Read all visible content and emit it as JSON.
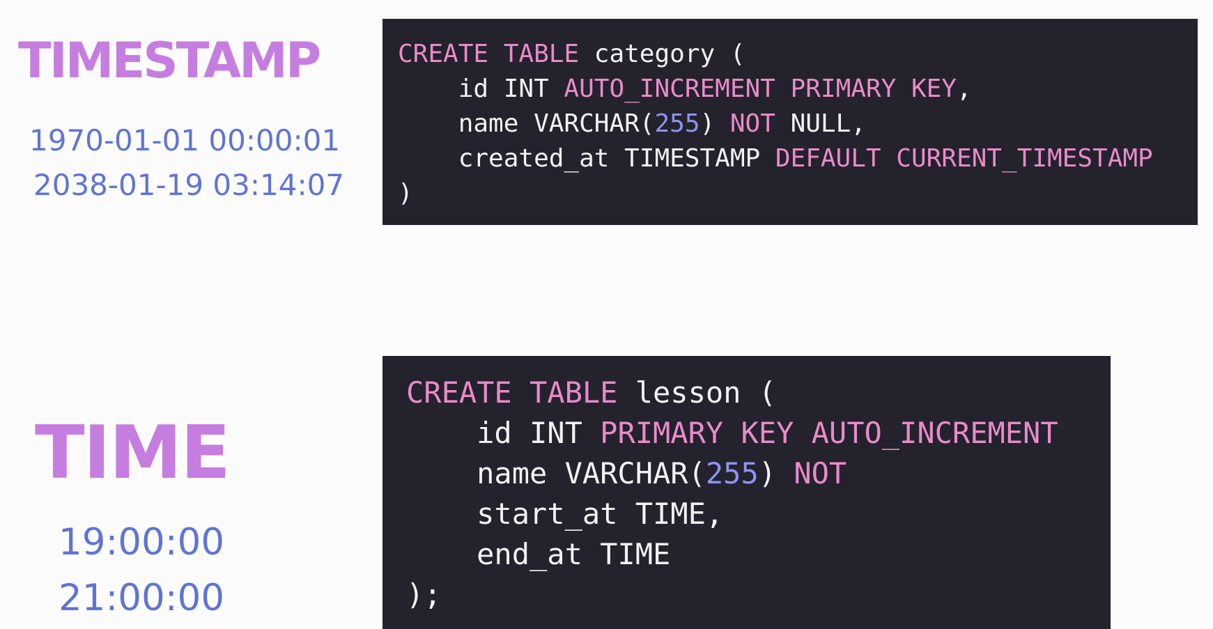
{
  "timestamp_section": {
    "heading": "TIMESTAMP",
    "range_min": "1970-01-01 00:00:01",
    "range_max": "2038-01-19 03:14:07",
    "code_lines": [
      [
        {
          "t": "CREATE",
          "k": "kw"
        },
        {
          "t": " ",
          "k": "plain"
        },
        {
          "t": "TABLE",
          "k": "kw"
        },
        {
          "t": " category (",
          "k": "plain"
        }
      ],
      [
        {
          "t": "    id INT ",
          "k": "plain"
        },
        {
          "t": "AUTO_INCREMENT",
          "k": "kw"
        },
        {
          "t": " ",
          "k": "plain"
        },
        {
          "t": "PRIMARY",
          "k": "kw"
        },
        {
          "t": " ",
          "k": "plain"
        },
        {
          "t": "KEY",
          "k": "kw"
        },
        {
          "t": ",",
          "k": "plain"
        }
      ],
      [
        {
          "t": "    name VARCHAR(",
          "k": "plain"
        },
        {
          "t": "255",
          "k": "num"
        },
        {
          "t": ") ",
          "k": "plain"
        },
        {
          "t": "NOT",
          "k": "kw"
        },
        {
          "t": " NULL,",
          "k": "plain"
        }
      ],
      [
        {
          "t": "    created_at TIMESTAMP ",
          "k": "plain"
        },
        {
          "t": "DEFAULT",
          "k": "kw"
        },
        {
          "t": " ",
          "k": "plain"
        },
        {
          "t": "CURRENT_TIMESTAMP",
          "k": "kw"
        }
      ],
      [
        {
          "t": ")",
          "k": "plain"
        }
      ]
    ]
  },
  "time_section": {
    "heading": "TIME",
    "value_start": "19:00:00",
    "value_end": "21:00:00",
    "code_lines": [
      [
        {
          "t": "CREATE",
          "k": "kw"
        },
        {
          "t": " ",
          "k": "plain"
        },
        {
          "t": "TABLE",
          "k": "kw"
        },
        {
          "t": " lesson (",
          "k": "plain"
        }
      ],
      [
        {
          "t": "    id INT ",
          "k": "plain"
        },
        {
          "t": "PRIMARY",
          "k": "kw"
        },
        {
          "t": " ",
          "k": "plain"
        },
        {
          "t": "KEY",
          "k": "kw"
        },
        {
          "t": " ",
          "k": "plain"
        },
        {
          "t": "AUTO_INCREMENT",
          "k": "kw"
        }
      ],
      [
        {
          "t": "    name VARCHAR(",
          "k": "plain"
        },
        {
          "t": "255",
          "k": "num"
        },
        {
          "t": ") ",
          "k": "plain"
        },
        {
          "t": "NOT",
          "k": "kw"
        }
      ],
      [
        {
          "t": "    start_at TIME,",
          "k": "plain"
        }
      ],
      [
        {
          "t": "    end_at TIME",
          "k": "plain"
        }
      ],
      [
        {
          "t": ");",
          "k": "plain"
        }
      ]
    ]
  },
  "colors": {
    "heading": "#c67de0",
    "range_text": "#5f74d6",
    "code_background": "#24222d",
    "code_keyword": "#e88bc9",
    "code_number": "#8d94f0",
    "code_text": "#f2f2f2",
    "page_background": "#fcfcfc"
  }
}
